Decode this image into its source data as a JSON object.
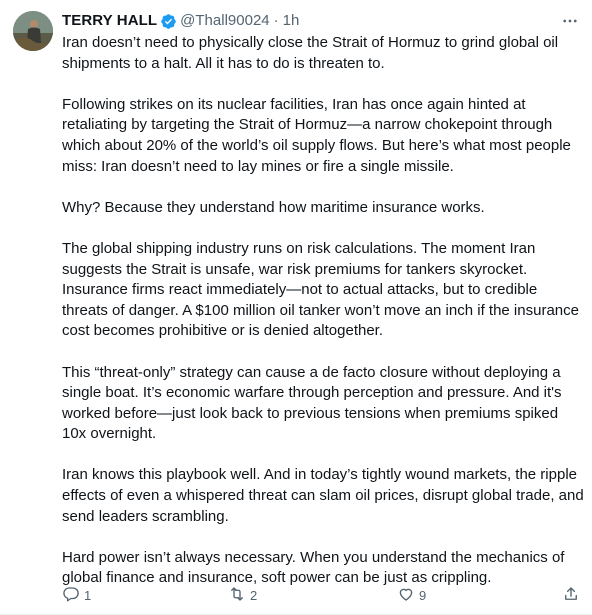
{
  "author": {
    "name": "TERRY HALL",
    "handle": "@Thall90024",
    "separator": "·",
    "time": "1h"
  },
  "icons": {
    "verified": "verified-badge-icon",
    "more": "more-icon",
    "reply": "reply-icon",
    "retweet": "retweet-icon",
    "like": "like-icon",
    "share": "share-icon"
  },
  "colors": {
    "verified": "#1d9bf0",
    "muted": "#536471",
    "text": "#0f1419"
  },
  "tweet": {
    "paragraphs": [
      "Iran doesn’t need to physically close the Strait of Hormuz to grind global oil shipments to a halt. All it has to do is threaten to.",
      "Following strikes on its nuclear facilities, Iran has once again hinted at retaliating by targeting the Strait of Hormuz—a narrow chokepoint through which about 20% of the world’s oil supply flows. But here’s what most people miss: Iran doesn’t need to lay mines or fire a single missile.",
      "Why? Because they understand how maritime insurance works.",
      "The global shipping industry runs on risk calculations. The moment Iran suggests the Strait is unsafe, war risk premiums for tankers skyrocket. Insurance firms react immediately—not to actual attacks, but to credible threats of danger. A $100 million oil tanker won’t move an inch if the insurance cost becomes prohibitive or is denied altogether.",
      "This “threat-only” strategy can cause a de facto closure without deploying a single boat. It’s economic warfare through perception and pressure. And it's worked before—just look back to previous tensions when premiums spiked 10x overnight.",
      "Iran knows this playbook well. And in today’s tightly wound markets, the ripple effects of even a whispered threat can slam oil prices, disrupt global trade, and send leaders scrambling.",
      "Hard power isn’t always necessary. When you understand the mechanics of global finance and insurance, soft power can be just as crippling."
    ]
  },
  "metrics": {
    "replies": "1",
    "retweets": "2",
    "likes": "9"
  }
}
